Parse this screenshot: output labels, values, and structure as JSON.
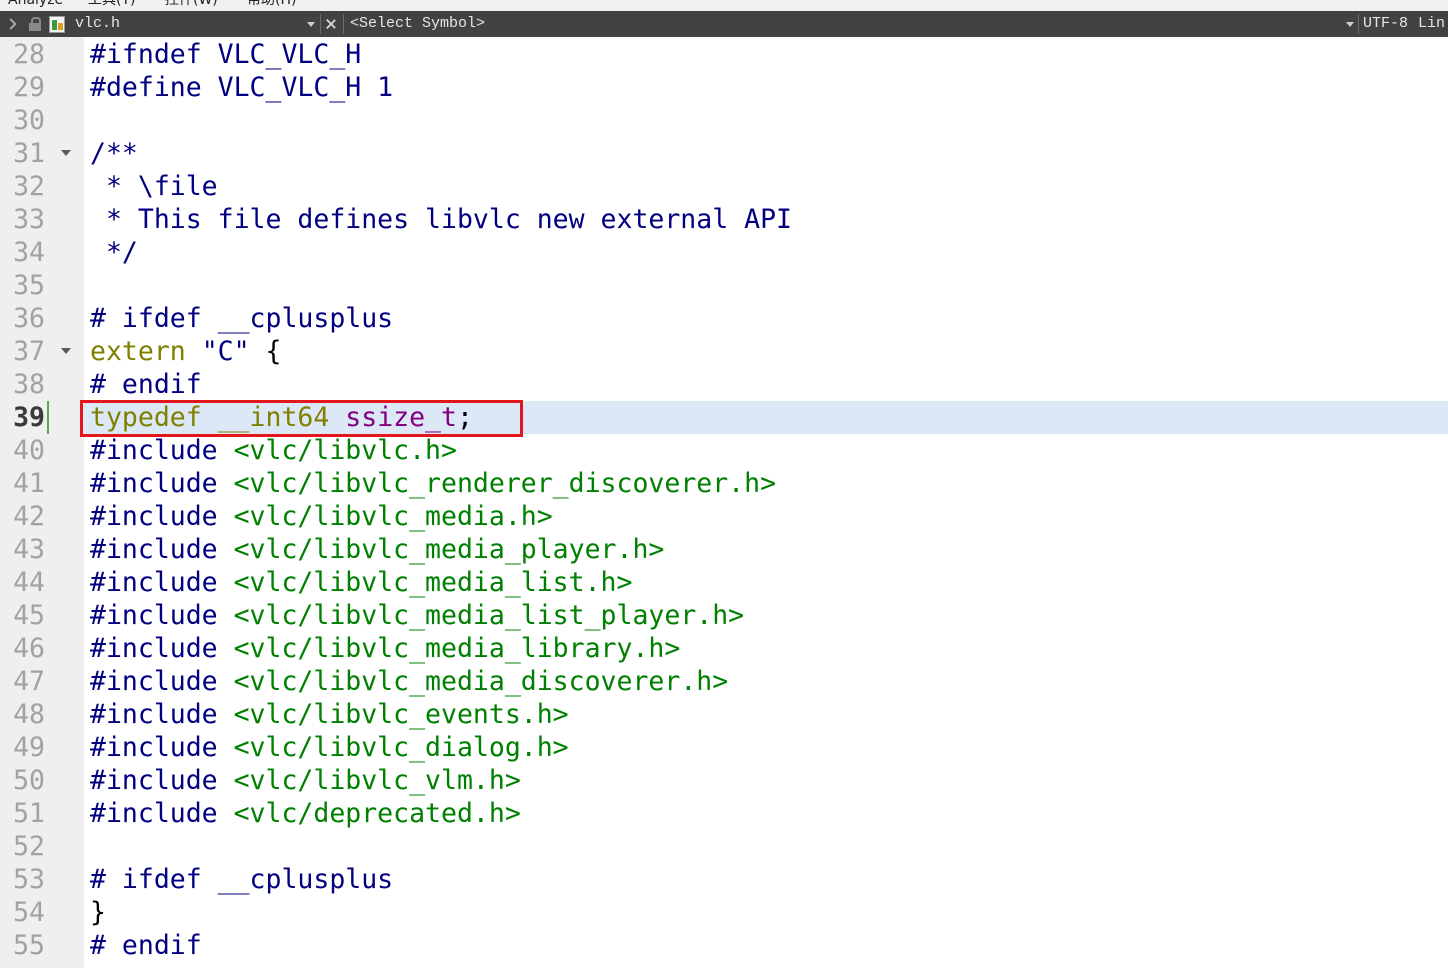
{
  "menubar": {
    "items": [
      {
        "label": "Analyze"
      },
      {
        "label": "工具(T)"
      },
      {
        "label": "控件(W)"
      },
      {
        "label": "帮助(H)"
      }
    ]
  },
  "toolbar": {
    "file_name": "vlc.h",
    "symbol_selector": "<Select Symbol>",
    "encoding": "UTF-8",
    "line_col": "Lin",
    "icons": {
      "nav": "chevron-right-icon",
      "lock": "lock-icon",
      "file": "file-icon",
      "dropdown": "chevron-down-icon",
      "close": "close-icon"
    }
  },
  "colors": {
    "pp": "#000080",
    "cm": "#000080",
    "kw": "#808000",
    "str": "#000080",
    "inc": "#008000",
    "ty": "#800080",
    "pl": "#000000",
    "annotation": "#e3161b",
    "current_line_bg": "#dde8f6"
  },
  "editor": {
    "lines": [
      {
        "num": "28",
        "tokens": [
          {
            "type": "pp",
            "text": "#ifndef VLC_VLC_H"
          }
        ]
      },
      {
        "num": "29",
        "tokens": [
          {
            "type": "pp",
            "text": "#define VLC_VLC_H 1"
          }
        ]
      },
      {
        "num": "30",
        "tokens": []
      },
      {
        "num": "31",
        "foldable": true,
        "tokens": [
          {
            "type": "cm",
            "text": "/**"
          }
        ]
      },
      {
        "num": "32",
        "tokens": [
          {
            "type": "cm",
            "text": " * \\file"
          }
        ]
      },
      {
        "num": "33",
        "tokens": [
          {
            "type": "cm",
            "text": " * This file defines libvlc new external API"
          }
        ]
      },
      {
        "num": "34",
        "tokens": [
          {
            "type": "cm",
            "text": " */"
          }
        ]
      },
      {
        "num": "35",
        "tokens": []
      },
      {
        "num": "36",
        "tokens": [
          {
            "type": "pp",
            "text": "# ifdef __cplusplus"
          }
        ]
      },
      {
        "num": "37",
        "foldable": true,
        "tokens": [
          {
            "type": "kw",
            "text": "extern "
          },
          {
            "type": "str",
            "text": "\"C\""
          },
          {
            "type": "pl",
            "text": " {"
          }
        ]
      },
      {
        "num": "38",
        "tokens": [
          {
            "type": "pp",
            "text": "# endif"
          }
        ]
      },
      {
        "num": "39",
        "current": true,
        "modified": true,
        "tokens": [
          {
            "type": "kw",
            "text": "typedef __int64 "
          },
          {
            "type": "ty",
            "text": "ssize_t"
          },
          {
            "type": "pl",
            "text": ";"
          }
        ]
      },
      {
        "num": "40",
        "tokens": [
          {
            "type": "pp",
            "text": "#include "
          },
          {
            "type": "inc",
            "text": "<vlc/libvlc.h>"
          }
        ]
      },
      {
        "num": "41",
        "tokens": [
          {
            "type": "pp",
            "text": "#include "
          },
          {
            "type": "inc",
            "text": "<vlc/libvlc_renderer_discoverer.h>"
          }
        ]
      },
      {
        "num": "42",
        "tokens": [
          {
            "type": "pp",
            "text": "#include "
          },
          {
            "type": "inc",
            "text": "<vlc/libvlc_media.h>"
          }
        ]
      },
      {
        "num": "43",
        "tokens": [
          {
            "type": "pp",
            "text": "#include "
          },
          {
            "type": "inc",
            "text": "<vlc/libvlc_media_player.h>"
          }
        ]
      },
      {
        "num": "44",
        "tokens": [
          {
            "type": "pp",
            "text": "#include "
          },
          {
            "type": "inc",
            "text": "<vlc/libvlc_media_list.h>"
          }
        ]
      },
      {
        "num": "45",
        "tokens": [
          {
            "type": "pp",
            "text": "#include "
          },
          {
            "type": "inc",
            "text": "<vlc/libvlc_media_list_player.h>"
          }
        ]
      },
      {
        "num": "46",
        "tokens": [
          {
            "type": "pp",
            "text": "#include "
          },
          {
            "type": "inc",
            "text": "<vlc/libvlc_media_library.h>"
          }
        ]
      },
      {
        "num": "47",
        "tokens": [
          {
            "type": "pp",
            "text": "#include "
          },
          {
            "type": "inc",
            "text": "<vlc/libvlc_media_discoverer.h>"
          }
        ]
      },
      {
        "num": "48",
        "tokens": [
          {
            "type": "pp",
            "text": "#include "
          },
          {
            "type": "inc",
            "text": "<vlc/libvlc_events.h>"
          }
        ]
      },
      {
        "num": "49",
        "tokens": [
          {
            "type": "pp",
            "text": "#include "
          },
          {
            "type": "inc",
            "text": "<vlc/libvlc_dialog.h>"
          }
        ]
      },
      {
        "num": "50",
        "tokens": [
          {
            "type": "pp",
            "text": "#include "
          },
          {
            "type": "inc",
            "text": "<vlc/libvlc_vlm.h>"
          }
        ]
      },
      {
        "num": "51",
        "tokens": [
          {
            "type": "pp",
            "text": "#include "
          },
          {
            "type": "inc",
            "text": "<vlc/deprecated.h>"
          }
        ]
      },
      {
        "num": "52",
        "tokens": []
      },
      {
        "num": "53",
        "tokens": [
          {
            "type": "pp",
            "text": "# ifdef __cplusplus"
          }
        ]
      },
      {
        "num": "54",
        "tokens": [
          {
            "type": "pl",
            "text": "}"
          }
        ]
      },
      {
        "num": "55",
        "tokens": [
          {
            "type": "pp",
            "text": "# endif"
          }
        ]
      }
    ]
  }
}
